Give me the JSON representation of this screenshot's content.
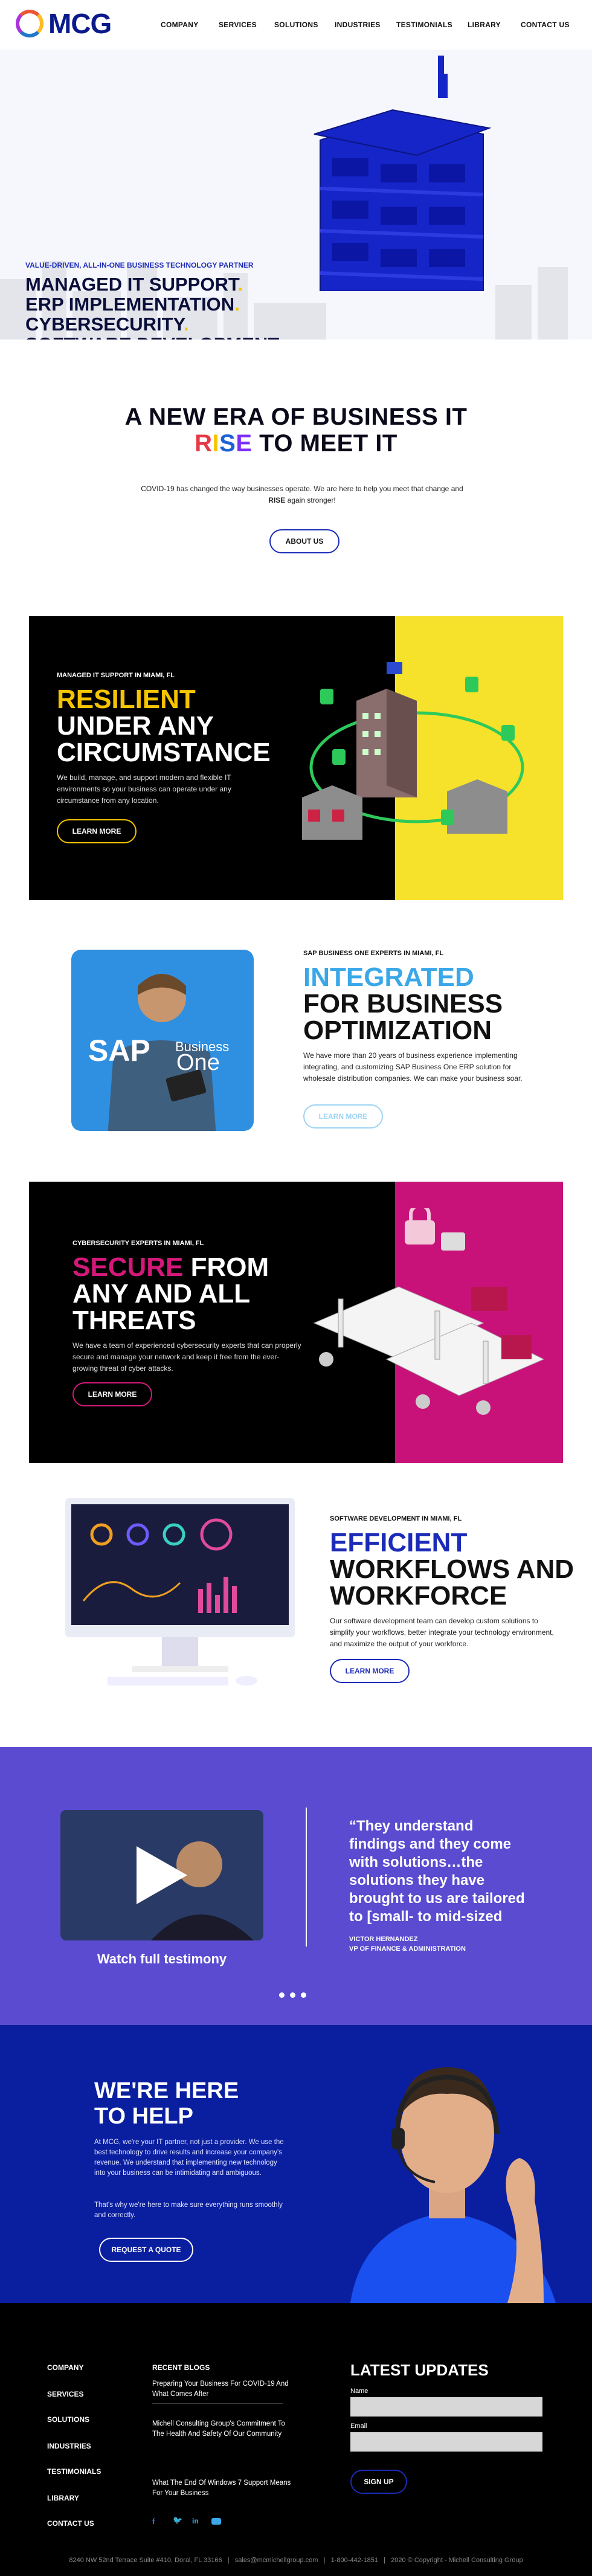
{
  "header": {
    "logo_text": "MCG",
    "nav": [
      "COMPANY",
      "SERVICES",
      "SOLUTIONS",
      "INDUSTRIES",
      "TESTIMONIALS",
      "LIBRARY",
      "CONTACT US"
    ]
  },
  "hero": {
    "kicker": "VALUE-DRIVEN, ALL-IN-ONE BUSINESS TECHNOLOGY PARTNER",
    "lines": [
      "MANAGED IT SUPPORT",
      "ERP IMPLEMENTATION",
      "CYBERSECURITY",
      "SOFTWARE DEVELOPMENT"
    ],
    "dot": ".",
    "dot_color": "#f5c400",
    "tower_color": "#1625c7"
  },
  "era": {
    "title_line1": "A NEW ERA OF BUSINESS IT",
    "rise_letters": [
      "R",
      "I",
      "S",
      "E"
    ],
    "rise_colors": [
      "#e63946",
      "#f5c400",
      "#1e63d6",
      "#7b2ff7"
    ],
    "title_line2_rest": " TO MEET IT",
    "para_part1": "COVID-19 has changed the way businesses operate. We are here to help you meet that change and ",
    "para_bold": "RISE",
    "para_part2": " again stronger!",
    "button": "ABOUT US"
  },
  "managed": {
    "kicker": "MANAGED IT SUPPORT IN MIAMI, FL",
    "accent_word": "RESILIENT",
    "accent_color": "#f5c400",
    "lines": [
      "UNDER ANY",
      "CIRCUMSTANCE"
    ],
    "para": "We build, manage, and support modern and flexible IT environments so your business can operate under any circumstance from any location.",
    "button": "LEARN MORE",
    "panel_color": "#f7e22b"
  },
  "sap": {
    "kicker": "SAP BUSINESS ONE EXPERTS IN MIAMI, FL",
    "accent_word": "INTEGRATED",
    "accent_color": "#3aa8e8",
    "lines": [
      "FOR BUSINESS",
      "OPTIMIZATION"
    ],
    "para": "We have more than 20 years of business experience implementing integrating, and customizing SAP Business One ERP solution for wholesale distribution companies. We can make your business soar.",
    "button": "LEARN MORE",
    "image_brand": "SAP",
    "image_product_1": "Business",
    "image_product_2": "One"
  },
  "security": {
    "kicker": "CYBERSECURITY EXPERTS IN MIAMI, FL",
    "accent_word": "SECURE",
    "accent_color": "#d4187a",
    "rest_first_line": " FROM",
    "lines": [
      "ANY AND ALL",
      "THREATS"
    ],
    "para": "We have a team of experienced cybersecurity experts that can properly secure and manage your network and keep it free from the ever-growing threat of cyber attacks.",
    "button": "LEARN MORE",
    "panel_color": "#c8127a"
  },
  "software": {
    "kicker": "SOFTWARE DEVELOPMENT IN MIAMI, FL",
    "accent_word": "EFFICIENT",
    "accent_color": "#1b2bb8",
    "lines": [
      "WORKFLOWS AND",
      "WORKFORCE"
    ],
    "para": "Our software development team can develop custom solutions to simplify your workflows, better integrate your technology environment, and maximize the output of your workforce.",
    "button": "LEARN MORE"
  },
  "testimonial": {
    "video_caption": "Watch full testimony",
    "quote": "“They understand findings and they come with solutions…the solutions they have brought to us are tailored to [small- to mid-sized",
    "author": "VICTOR HERNANDEZ",
    "role": "VP OF FINANCE & ADMINISTRATION"
  },
  "help": {
    "title_line1": "WE'RE HERE",
    "title_line2": "TO HELP",
    "para1": "At MCG, we're your IT partner, not just a provider. We use the best technology to drive results and increase your company's revenue. We understand that implementing new technology into your business can be intimidating and ambiguous.",
    "para2": "That's why we're here to make sure everything runs smoothly and correctly.",
    "button": "REQUEST A QUOTE"
  },
  "footer": {
    "links": [
      "COMPANY",
      "SERVICES",
      "SOLUTIONS",
      "INDUSTRIES",
      "TESTIMONIALS",
      "LIBRARY",
      "CONTACT US"
    ],
    "recent_heading": "RECENT BLOGS",
    "blogs": [
      "Preparing Your Business For COVID-19 And What Comes After",
      "Michell Consulting Group's Commitment To The Health And Safety Of Our Community",
      "What The End Of Windows 7 Support Means For Your Business"
    ],
    "updates_heading": "LATEST UPDATES",
    "name_label": "Name",
    "email_label": "Email",
    "signup_button": "SIGN UP",
    "bottom": "8240 NW 52nd Terrace Suite #410, Doral, FL 33166   |   sales@mcmichellgroup.com   |   1-800-442-1851   |   2020 © Copyright - Michell Consulting Group"
  }
}
